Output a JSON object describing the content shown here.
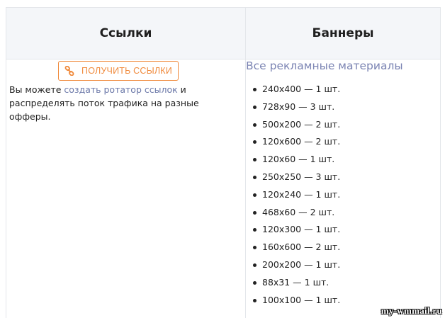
{
  "table": {
    "header": {
      "links": "Ссылки",
      "banners": "Баннеры"
    },
    "links_cell": {
      "button_label": "ПОЛУЧИТЬ ССЫЛКИ",
      "button_icon": "link-icon",
      "text_before": "Вы можете ",
      "link_text": "создать ротатор ссылок",
      "text_after": " и распределять поток трафика на разные офферы."
    },
    "banners_cell": {
      "title": "Все рекламные материалы",
      "items": [
        "240x400 — 1 шт.",
        "728x90 — 3 шт.",
        "500x200 — 2 шт.",
        "120x600 — 2 шт.",
        "120x60 — 1 шт.",
        "250x250 — 3 шт.",
        "120x240 — 1 шт.",
        "468x60 — 2 шт.",
        "120x300 — 1 шт.",
        "160x600 — 2 шт.",
        "200x200 — 1 шт.",
        "88x31 — 1 шт.",
        "100x100 — 1 шт."
      ]
    }
  },
  "colors": {
    "accent_orange": "#f08a3c",
    "link_blue": "#6b78a8",
    "title_purple": "#7b84b3",
    "header_bg": "#f4f6f9"
  },
  "watermark": "my-wmmail.ru"
}
